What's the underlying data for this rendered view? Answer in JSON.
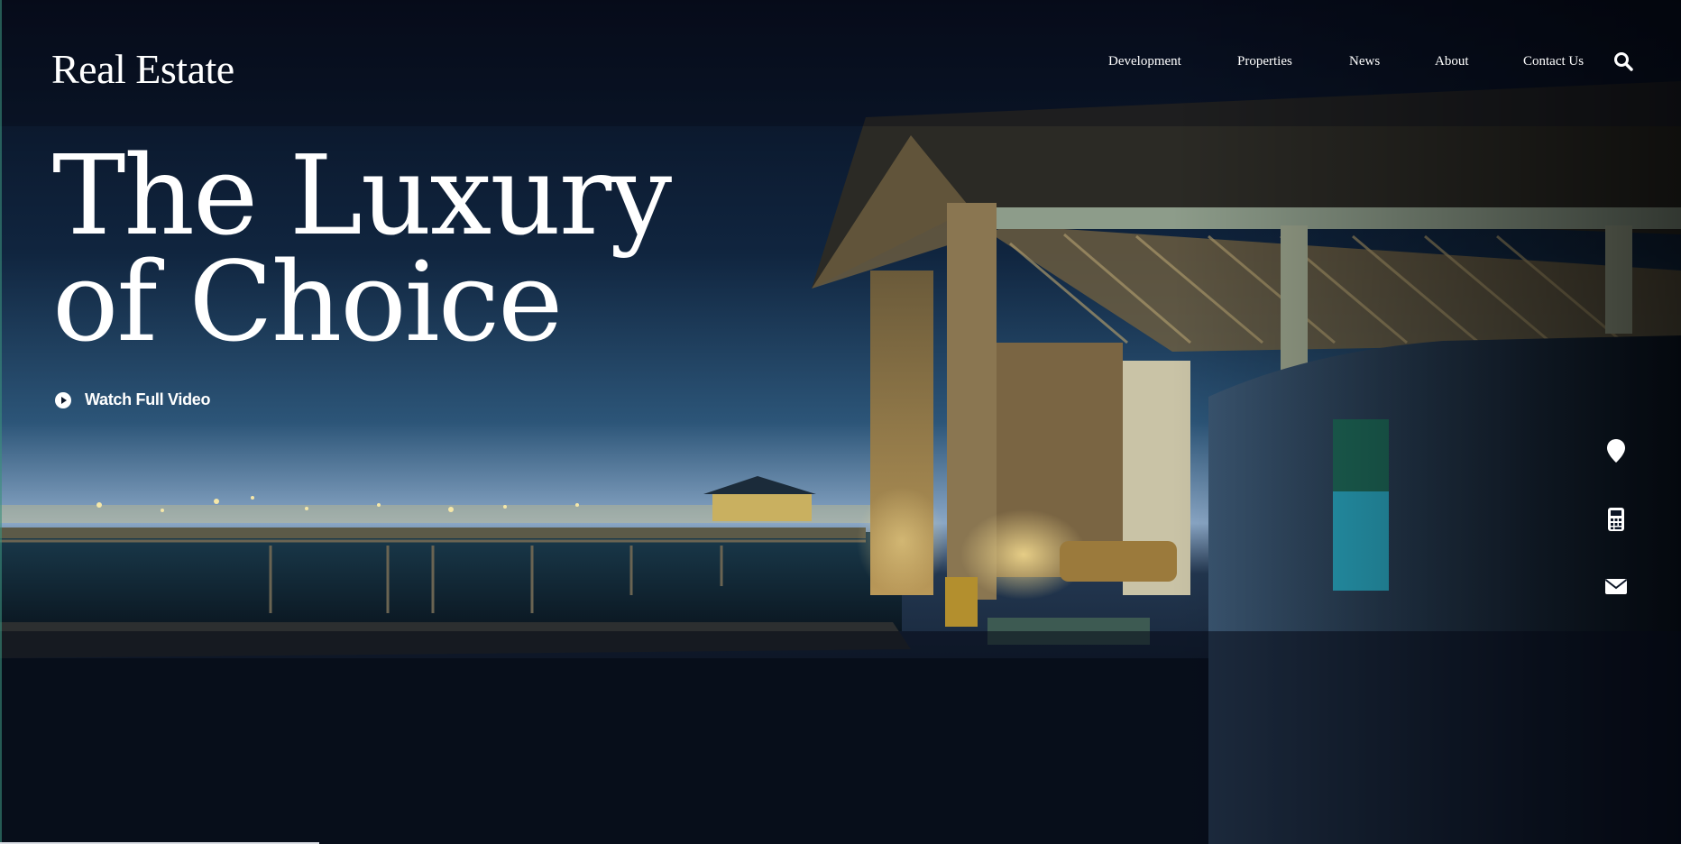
{
  "brand": {
    "logo_text": "Real Estate"
  },
  "nav": {
    "items": [
      {
        "label": "Development"
      },
      {
        "label": "Properties"
      },
      {
        "label": "News"
      },
      {
        "label": "About"
      },
      {
        "label": "Contact Us"
      }
    ],
    "search_icon": "search-icon"
  },
  "hero": {
    "title_line1": "The Luxury",
    "title_line2": "of Choice",
    "video_button": {
      "label": "Watch Full Video",
      "icon": "play-circle-icon"
    },
    "slide_progress": 0.19
  },
  "side_actions": [
    {
      "icon": "map-pin-icon"
    },
    {
      "icon": "calculator-icon"
    },
    {
      "icon": "envelope-icon"
    }
  ],
  "colors": {
    "sky_top": "#0a1326",
    "sky_mid": "#1f4a6d",
    "horizon": "#9bb6d2",
    "warm_light": "#e9c77a",
    "text": "#ffffff"
  }
}
